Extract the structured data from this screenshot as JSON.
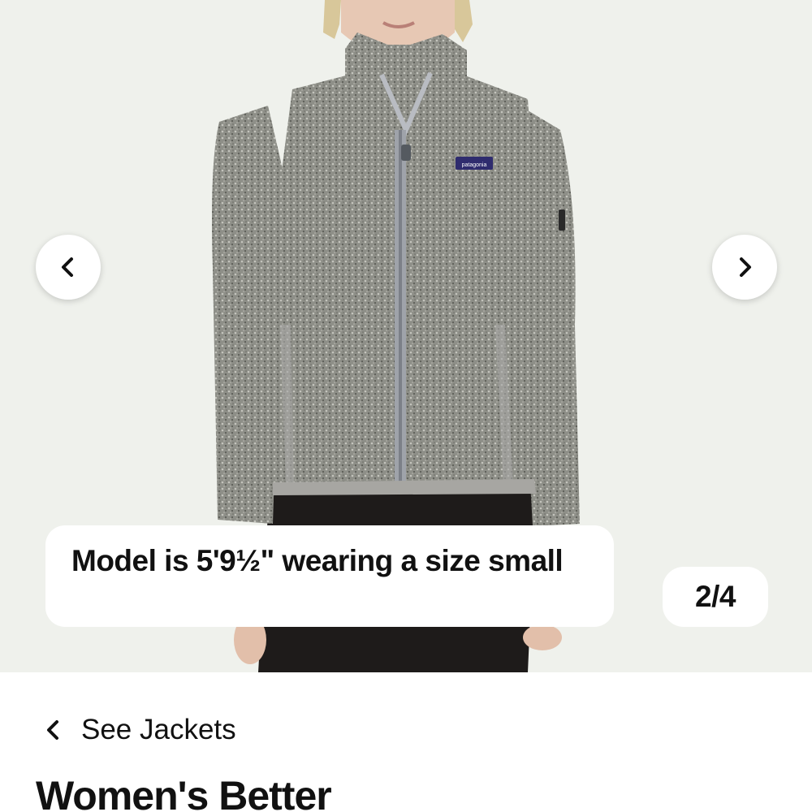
{
  "gallery": {
    "caption": "Model is 5'9½\" wearing a size small",
    "counter": "2/4",
    "prev_icon": "chevron-left-icon",
    "next_icon": "chevron-right-icon",
    "brand_patch": "patagonia"
  },
  "breadcrumb": {
    "back_label": "See Jackets",
    "back_icon": "chevron-left-icon"
  },
  "product": {
    "title": "Women's Better"
  },
  "colors": {
    "gallery_bg": "#eff1ec",
    "fleece": "#8e8f88",
    "text": "#111111"
  }
}
